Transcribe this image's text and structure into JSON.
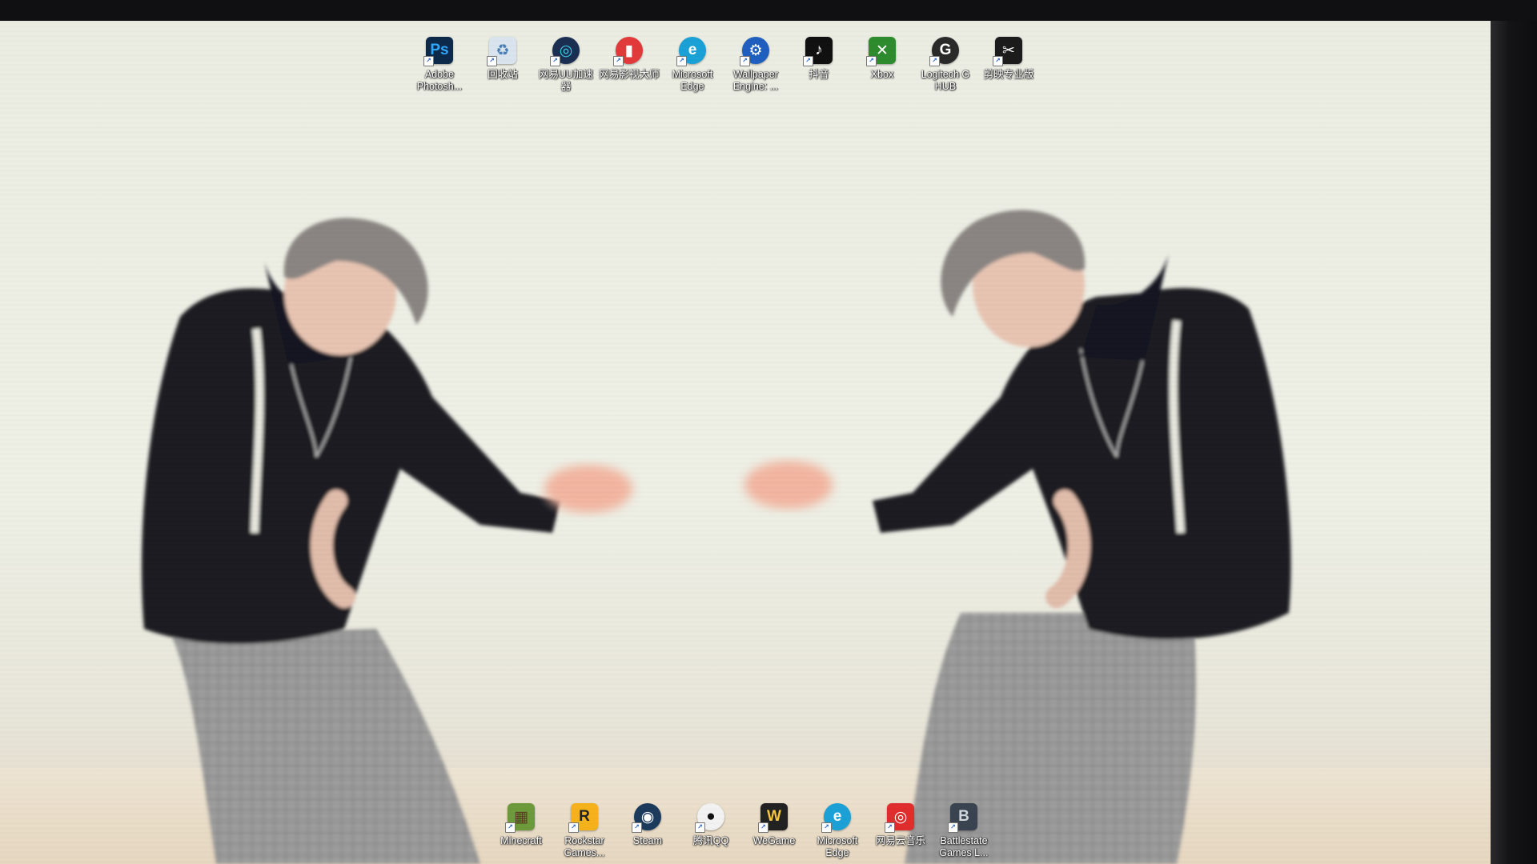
{
  "desktop": {
    "top_icons": [
      {
        "label": "Adobe Photosh...",
        "icon": "photoshop-icon",
        "glyph": "Ps",
        "color": "#0d2a4a",
        "fg": "#31a8ff",
        "round": false
      },
      {
        "label": "回收站",
        "icon": "recycle-bin-icon",
        "glyph": "♻",
        "color": "#d9e4ee",
        "fg": "#4a7fb5",
        "round": false
      },
      {
        "label": "网易UU加速器",
        "icon": "uu-accelerator-icon",
        "glyph": "◎",
        "color": "#1b2f52",
        "fg": "#3fd0e6",
        "round": true
      },
      {
        "label": "网易影视大师",
        "icon": "netease-video-icon",
        "glyph": "▮",
        "color": "#e23a3a",
        "fg": "#ffffff",
        "round": true
      },
      {
        "label": "Microsoft Edge",
        "icon": "edge-icon",
        "glyph": "e",
        "color": "#1ba1d6",
        "fg": "#ffffff",
        "round": true
      },
      {
        "label": "Wallpaper Engine: ...",
        "icon": "wallpaper-engine-icon",
        "glyph": "⚙",
        "color": "#1f5fbf",
        "fg": "#ffffff",
        "round": true
      },
      {
        "label": "抖音",
        "icon": "douyin-icon",
        "glyph": "♪",
        "color": "#111111",
        "fg": "#ffffff",
        "round": false
      },
      {
        "label": "Xbox",
        "icon": "xbox-icon",
        "glyph": "✕",
        "color": "#2e8b2e",
        "fg": "#ffffff",
        "round": false
      },
      {
        "label": "Logitech G HUB",
        "icon": "logitech-ghub-icon",
        "glyph": "G",
        "color": "#2a2a2a",
        "fg": "#ffffff",
        "round": true
      },
      {
        "label": "剪映专业版",
        "icon": "capcut-icon",
        "glyph": "✂",
        "color": "#1c1c1c",
        "fg": "#ffffff",
        "round": false
      }
    ],
    "bottom_icons": [
      {
        "label": "Minecraft",
        "icon": "minecraft-icon",
        "glyph": "▦",
        "color": "#6d9a3a",
        "fg": "#5b3d22",
        "round": false
      },
      {
        "label": "Rockstar Games...",
        "icon": "rockstar-icon",
        "glyph": "R",
        "color": "#f5b21a",
        "fg": "#222222",
        "round": false
      },
      {
        "label": "Steam",
        "icon": "steam-icon",
        "glyph": "◉",
        "color": "#1b3a5c",
        "fg": "#ffffff",
        "round": true
      },
      {
        "label": "腾讯QQ",
        "icon": "qq-icon",
        "glyph": "●",
        "color": "#f2f2f2",
        "fg": "#111111",
        "round": true
      },
      {
        "label": "WeGame",
        "icon": "wegame-icon",
        "glyph": "W",
        "color": "#222222",
        "fg": "#f5c542",
        "round": false
      },
      {
        "label": "Microsoft Edge",
        "icon": "edge-icon",
        "glyph": "e",
        "color": "#1ba1d6",
        "fg": "#ffffff",
        "round": true
      },
      {
        "label": "网易云音乐",
        "icon": "netease-music-icon",
        "glyph": "◎",
        "color": "#e02d2d",
        "fg": "#ffffff",
        "round": false
      },
      {
        "label": "Battlestate Games L...",
        "icon": "battlestate-launcher-icon",
        "glyph": "B",
        "color": "#3a4450",
        "fg": "#d0d6dc",
        "round": false
      }
    ]
  }
}
